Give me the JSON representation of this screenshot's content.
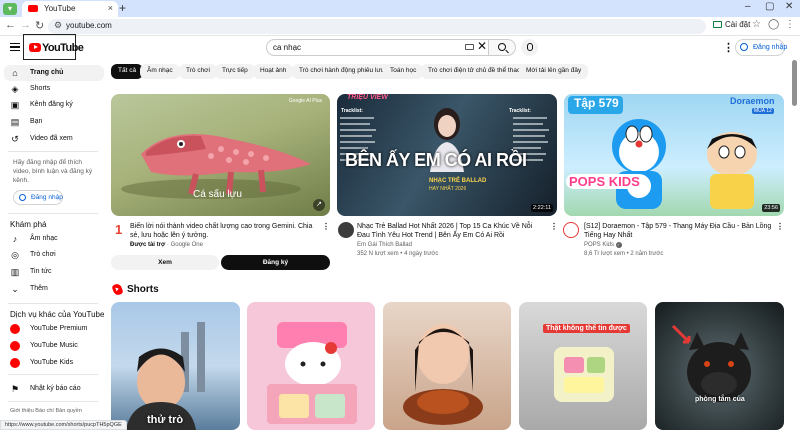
{
  "browser": {
    "tab_title": "YouTube",
    "url": "youtube.com",
    "install_label": "Cài đặt"
  },
  "header": {
    "logo_text": "YouTube",
    "search_value": "ca nhạc",
    "signin_label": "Đăng nhập"
  },
  "sidebar": {
    "main": [
      {
        "label": "Trang chủ",
        "icon": "home-icon"
      },
      {
        "label": "Shorts",
        "icon": "shorts-icon"
      },
      {
        "label": "Kênh đăng ký",
        "icon": "subscriptions-icon"
      },
      {
        "label": "Bạn",
        "icon": "you-icon"
      },
      {
        "label": "Video đã xem",
        "icon": "history-icon"
      }
    ],
    "signin_hint": "Hãy đăng nhập để thích video, bình luận và đăng ký kênh.",
    "signin_label": "Đăng nhập",
    "explore_heading": "Khám phá",
    "explore": [
      {
        "label": "Âm nhạc",
        "icon": "music-icon"
      },
      {
        "label": "Trò chơi",
        "icon": "gaming-icon"
      },
      {
        "label": "Tin tức",
        "icon": "news-icon"
      },
      {
        "label": "Thêm",
        "icon": "chevron-down-icon"
      }
    ],
    "more_heading": "Dịch vụ khác của YouTube",
    "more": [
      {
        "label": "YouTube Premium"
      },
      {
        "label": "YouTube Music"
      },
      {
        "label": "YouTube Kids"
      }
    ],
    "report_label": "Nhật ký báo cáo",
    "footer": "Giới thiệu  Báo chí  Bản quyền"
  },
  "chips": [
    "Tất cả",
    "Âm nhạc",
    "Trò chơi",
    "Trực tiếp",
    "Hoạt ảnh",
    "Trò chơi hành động phiêu lưu",
    "Toán học",
    "Trò chơi điện tử chủ đề thể thao",
    "Mới tải lên gần đây"
  ],
  "ad": {
    "thumb_caption": "Cá sấu lựu",
    "thumb_badge": "Google AI Plus",
    "title": "Biến lời nói thành video chất lượng cao trong Gemini. Chia sẻ, lưu hoặc lên ý tưởng.",
    "sponsor_prefix": "Được tài trợ",
    "sponsor": "Google One",
    "watch_label": "Xem",
    "subscribe_label": "Đăng ký"
  },
  "videos": [
    {
      "title": "Nhạc Trẻ Ballad Hot Nhất 2026 | Top 15 Ca Khúc Về Nỗi Đau Tình Yêu Hot Trend | Bên Ấy Em Có Ai Rồi",
      "channel": "Em Gái Thích Ballad",
      "meta": "352 N lượt xem • 4 ngày trước",
      "duration": "2:22:11",
      "thumb_banner": "TRIỆU VIEW",
      "thumb_title": "BÊN ẤY EM CÓ AI RỒI",
      "thumb_sub": "NHẠC TRẺ BALLAD",
      "thumb_year": "HAY NHẤT 2026",
      "tracklist_label": "Tracklist:"
    },
    {
      "title": "[S12] Doraemon - Tập 579 - Thang Máy Địa Cầu - Bản Lồng Tiếng Hay Nhất",
      "channel": "POPS Kids",
      "meta": "8,6 Tr lượt xem • 2 năm trước",
      "duration": "23:56",
      "thumb_ep": "Tập 579",
      "thumb_brand": "Doraemon",
      "thumb_season": "MÙA 12",
      "thumb_pops": "POPS KIDS"
    }
  ],
  "shorts": {
    "heading": "Shorts",
    "items": [
      {
        "caption": "thử trò"
      },
      {
        "caption": ""
      },
      {
        "caption": ""
      },
      {
        "caption": "Thật không thể tin được"
      },
      {
        "caption": "phòng tắm của"
      }
    ]
  },
  "status_url": "https://www.youtube.com/shorts/pucpTH5pQGE"
}
